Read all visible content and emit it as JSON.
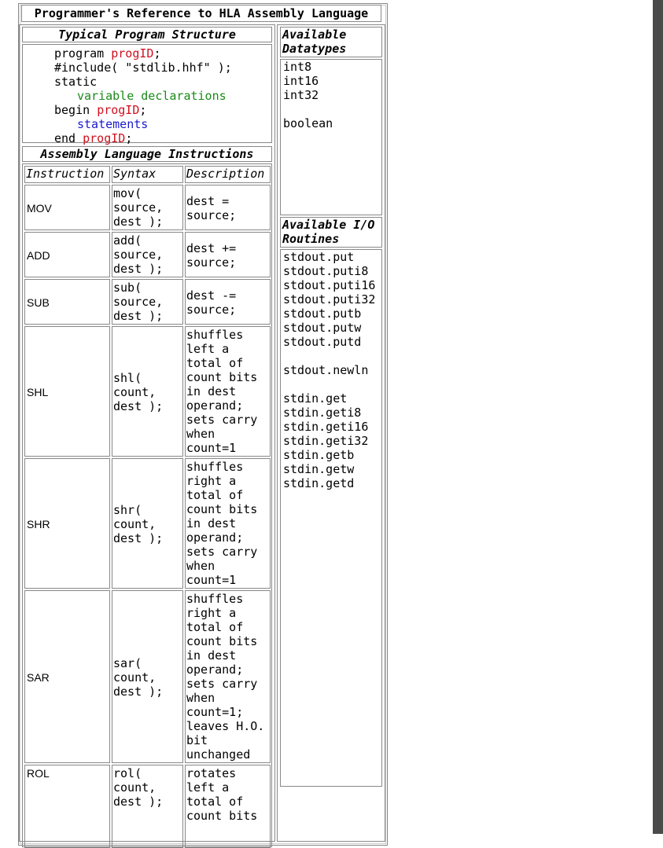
{
  "title": "Programmer's Reference to HLA Assembly Language",
  "program_structure": {
    "heading": "Typical Program Structure",
    "lines": [
      {
        "parts": [
          {
            "text": "program ",
            "c": ""
          },
          {
            "text": "progID",
            "c": "red"
          },
          {
            "text": ";",
            "c": ""
          }
        ],
        "indent": 0
      },
      {
        "parts": [
          {
            "text": "#include( \"stdlib.hhf\" );",
            "c": ""
          }
        ],
        "indent": 0
      },
      {
        "parts": [
          {
            "text": "static",
            "c": ""
          }
        ],
        "indent": 0
      },
      {
        "parts": [
          {
            "text": "variable declarations",
            "c": "green"
          }
        ],
        "indent": 1
      },
      {
        "parts": [
          {
            "text": "begin ",
            "c": ""
          },
          {
            "text": "progID",
            "c": "red"
          },
          {
            "text": ";",
            "c": ""
          }
        ],
        "indent": 0
      },
      {
        "parts": [
          {
            "text": "statements",
            "c": "blue"
          }
        ],
        "indent": 1
      },
      {
        "parts": [
          {
            "text": "end ",
            "c": ""
          },
          {
            "text": "progID",
            "c": "red"
          },
          {
            "text": ";",
            "c": ""
          }
        ],
        "indent": 0
      }
    ]
  },
  "instructions": {
    "heading": "Assembly Language Instructions",
    "columns": [
      "Instruction",
      "Syntax",
      "Description"
    ],
    "rows": [
      {
        "mnemonic": "MOV",
        "syntax": "mov(\nsource,\ndest );",
        "description": "dest =\nsource;"
      },
      {
        "mnemonic": "ADD",
        "syntax": "add(\nsource,\ndest );",
        "description": "dest +=\nsource;"
      },
      {
        "mnemonic": "SUB",
        "syntax": "sub(\nsource,\ndest );",
        "description": "dest -=\nsource;"
      },
      {
        "mnemonic": "SHL",
        "syntax": "shl(\ncount,\ndest );",
        "description": "shuffles\nleft a\ntotal of\ncount bits\nin dest\noperand;\nsets carry\nwhen\ncount=1"
      },
      {
        "mnemonic": "SHR",
        "syntax": "shr(\ncount,\ndest );",
        "description": "shuffles\nright a\ntotal of\ncount bits\nin dest\noperand;\nsets carry\nwhen\ncount=1"
      },
      {
        "mnemonic": "SAR",
        "syntax": "sar(\ncount,\ndest );",
        "description": "shuffles\nright a\ntotal of\ncount bits\nin dest\noperand;\nsets carry\nwhen\ncount=1;\nleaves H.O.\nbit\nunchanged"
      },
      {
        "mnemonic": "ROL",
        "syntax": "rol(\ncount,\ndest );",
        "description": "rotates\nleft a\ntotal of\ncount bits"
      }
    ]
  },
  "datatypes": {
    "heading": "Available\nDatatypes",
    "items": "int8\nint16\nint32\n\nboolean"
  },
  "io_routines": {
    "heading": "Available I/O\nRoutines",
    "items": "stdout.put\nstdout.puti8\nstdout.puti16\nstdout.puti32\nstdout.putb\nstdout.putw\nstdout.putd\n\nstdout.newln\n\nstdin.get\nstdin.geti8\nstdin.geti16\nstdin.geti32\nstdin.getb\nstdin.getw\nstdin.getd"
  }
}
